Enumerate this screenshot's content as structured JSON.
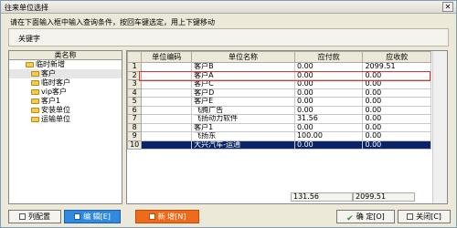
{
  "window": {
    "title": "往来单位选择"
  },
  "hint": "请在下面输入框中输入查询条件，按回车键选定，用上下键移动",
  "keyword": {
    "label": "关键字",
    "value": ""
  },
  "tree": {
    "header": "类名称",
    "items": [
      "临时新增",
      "客户",
      "临时客户",
      "vip客户",
      "客户1",
      "安装单位",
      "运输单位"
    ],
    "selected_index": 1
  },
  "grid": {
    "columns": [
      "单位编码",
      "单位名称",
      "应付款",
      "应收款"
    ],
    "rows": [
      {
        "no": "1",
        "code": "",
        "name": "客户B",
        "payable": "0.00",
        "receivable": "2099.51"
      },
      {
        "no": "2",
        "code": "",
        "name": "客户A",
        "payable": "0.00",
        "receivable": "0.00"
      },
      {
        "no": "3",
        "code": "",
        "name": "客户C",
        "payable": "0.00",
        "receivable": "0.00"
      },
      {
        "no": "4",
        "code": "",
        "name": "客户D",
        "payable": "0.00",
        "receivable": "0.00"
      },
      {
        "no": "5",
        "code": "",
        "name": "客户E",
        "payable": "0.00",
        "receivable": "0.00"
      },
      {
        "no": "6",
        "code": "",
        "name": "飞腾广告",
        "payable": "0.00",
        "receivable": "0.00"
      },
      {
        "no": "7",
        "code": "",
        "name": "飞扬动力软件",
        "payable": "31.56",
        "receivable": "0.00"
      },
      {
        "no": "8",
        "code": "",
        "name": "客户1",
        "payable": "0.00",
        "receivable": "0.00"
      },
      {
        "no": "9",
        "code": "",
        "name": "飞扬东",
        "payable": "100.00",
        "receivable": "0.00"
      },
      {
        "no": "10",
        "code": "",
        "name": "大兴汽车-运通",
        "payable": "0.00",
        "receivable": "0.00"
      }
    ],
    "selected_row": 9,
    "totals": {
      "payable": "131.56",
      "receivable": "2099.51"
    },
    "highlight_color": "#e03030"
  },
  "buttons": {
    "columns": "列配置",
    "edit": "编  辑[E]",
    "add": "新  增[N]",
    "ok": "确  定[O]",
    "close": "关闭[C]"
  },
  "colors": {
    "selection": "#0a246a",
    "edit_button": "#2f8ae0",
    "add_button": "#f06a1c"
  }
}
